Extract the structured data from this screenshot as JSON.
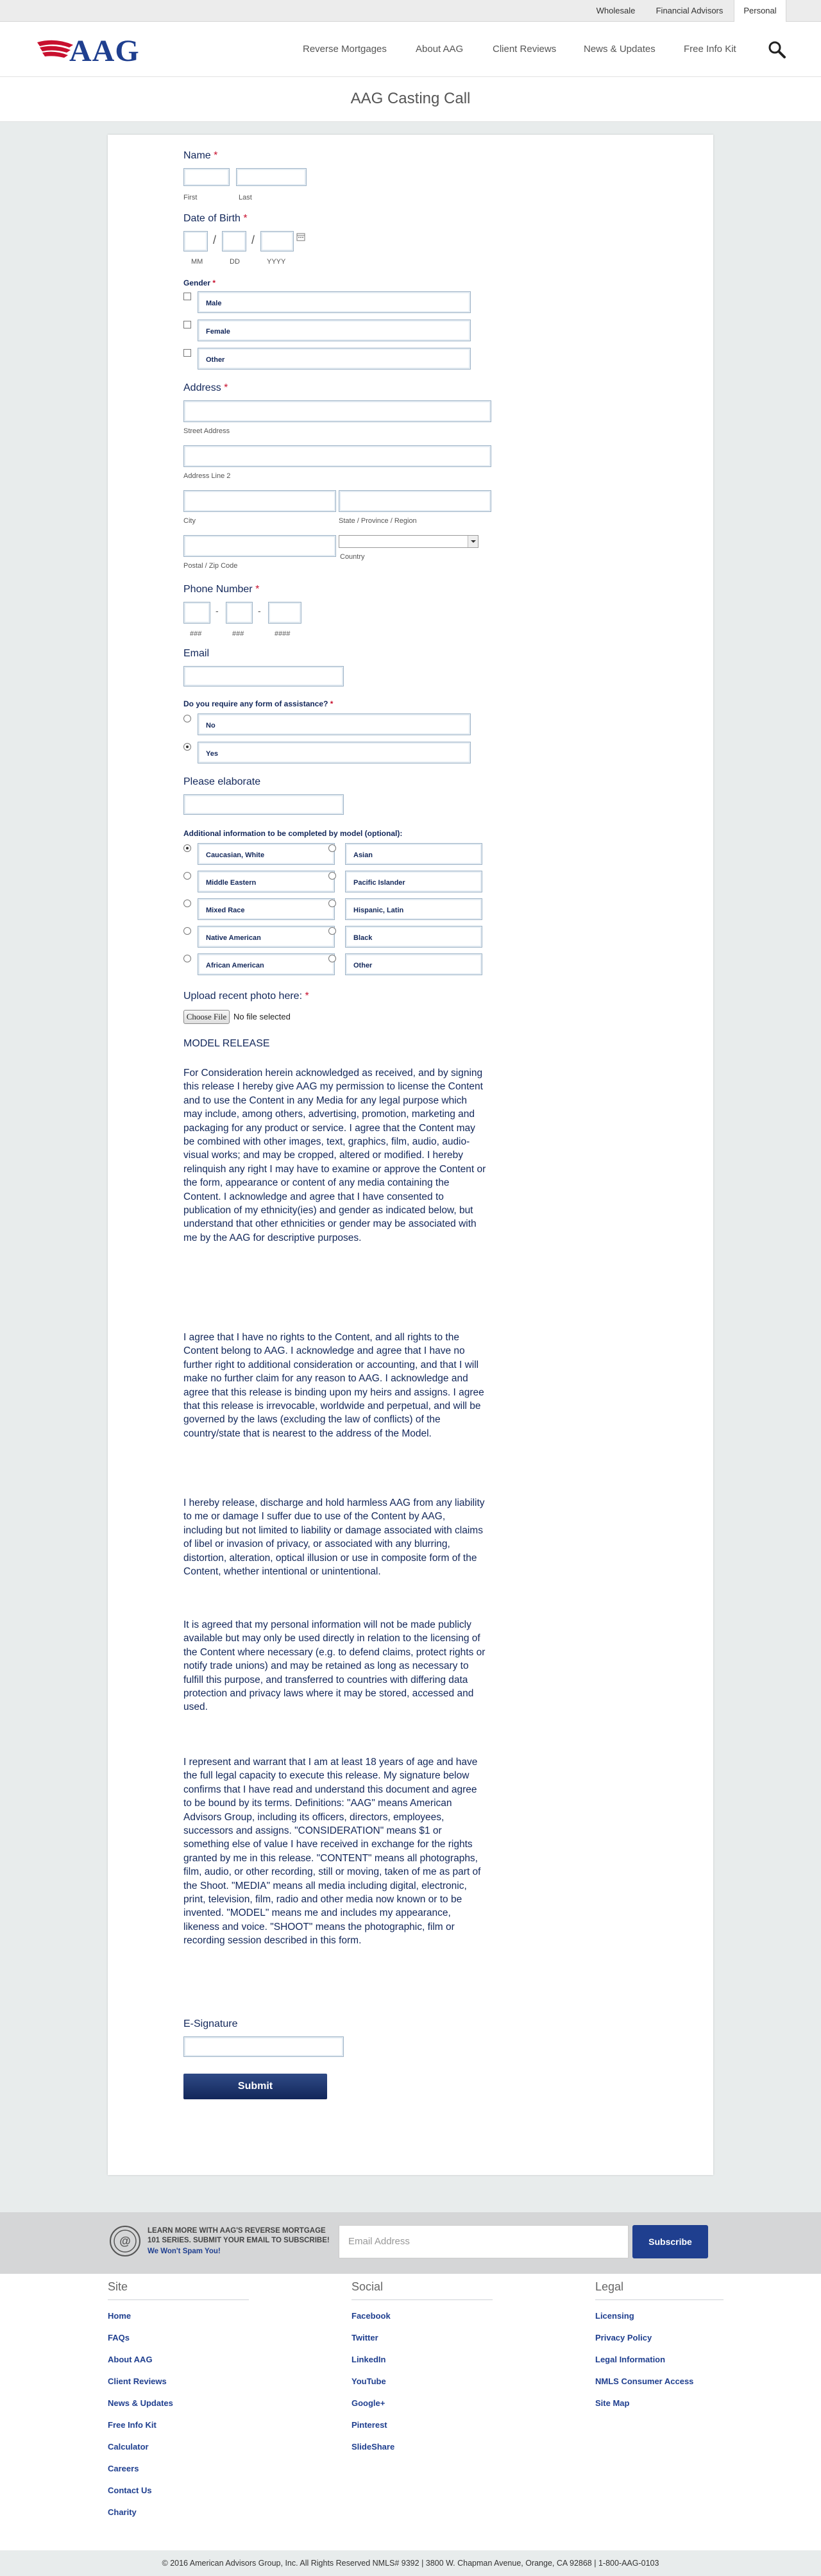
{
  "topbar": {
    "tabs": [
      "Wholesale",
      "Financial Advisors",
      "Personal"
    ]
  },
  "header": {
    "logo": "AAG",
    "nav": [
      "Reverse Mortgages",
      "About AAG",
      "Client Reviews",
      "News & Updates",
      "Free Info Kit"
    ]
  },
  "page": {
    "title": "AAG Casting Call"
  },
  "form": {
    "name": {
      "label": "Name",
      "req": "*",
      "first": "First",
      "last": "Last"
    },
    "dob": {
      "label": "Date of Birth",
      "req": "*",
      "mm": "MM",
      "dd": "DD",
      "yyyy": "YYYY",
      "sep": "/"
    },
    "gender": {
      "label": "Gender",
      "req": "*",
      "options": [
        "Male",
        "Female",
        "Other"
      ]
    },
    "address": {
      "label": "Address",
      "req": "*",
      "street": "Street Address",
      "line2": "Address Line 2",
      "city": "City",
      "state": "State / Province / Region",
      "postal": "Postal / Zip Code",
      "country": "Country"
    },
    "phone": {
      "label": "Phone Number",
      "req": "*",
      "area": "###",
      "prefix": "###",
      "line": "####",
      "sep": "-"
    },
    "email": {
      "label": "Email"
    },
    "assistance": {
      "label": "Do you require any form of assistance?",
      "req": "*",
      "options": [
        "No",
        "Yes"
      ],
      "selected": "Yes"
    },
    "elaborate": {
      "label": "Please elaborate"
    },
    "model_info": {
      "label": "Additional information to be completed by model (optional):",
      "left": [
        "Caucasian, White",
        "Middle Eastern",
        "Mixed Race",
        "Native American",
        "African American"
      ],
      "right": [
        "Asian",
        "Pacific Islander",
        "Hispanic, Latin",
        "Black",
        "Other"
      ],
      "selected": "Caucasian, White"
    },
    "upload": {
      "label": "Upload recent photo here:",
      "req": "*",
      "button": "Choose File",
      "status": "No file selected"
    },
    "release": {
      "heading": "MODEL RELEASE",
      "paragraphs": [
        "For Consideration herein acknowledged as received, and by signing this release I hereby give AAG my permission to license the Content and to use the Content in any Media for any legal purpose which may include, among others, advertising, promotion, marketing and packaging for any product or service. I agree that the Content may be combined with other images, text, graphics, film, audio, audio-visual works; and may be cropped, altered or modified. I hereby relinquish any right I may have to examine or approve the Content or the form, appearance or content of any media containing the Content. I acknowledge and agree that I have consented to publication of my ethnicity(ies) and gender as indicated below, but understand that other ethnicities or gender may be associated with me by the AAG for descriptive purposes.",
        "I agree that I have no rights to the Content, and all rights to the Content belong to AAG. I acknowledge and agree that I have no further right to additional consideration or accounting, and that I will make no further claim for any reason to AAG. I acknowledge and agree that this release is binding upon my heirs and assigns. I agree that this release is irrevocable, worldwide and perpetual, and will be governed by the laws (excluding the law of conflicts) of the country/state that is nearest to the address of the Model.",
        "I hereby release, discharge and hold harmless AAG from any liability to me or damage I suffer due to use of the Content by AAG, including but not limited to liability or damage associated with claims of libel or invasion of privacy, or associated with any blurring, distortion, alteration, optical illusion or use in composite form of the Content, whether intentional or unintentional.",
        "It is agreed that my personal information will not be made publicly available but may only be used directly in relation to the licensing of the Content where necessary (e.g. to defend claims, protect rights or notify trade unions) and may be retained as long as necessary to fulfill this purpose, and transferred to countries with differing data protection and privacy laws where it may be stored, accessed and used.",
        "I represent and warrant that I am at least 18 years of age and have the full legal capacity to execute this release. My signature below confirms that I have read and understand this document and agree to be bound by its terms. Definitions: \"AAG\" means American Advisors Group, including its officers, directors, employees, successors and assigns. \"CONSIDERATION\" means $1 or something else of value I have received in exchange for the rights granted by me in this release. \"CONTENT\" means all photographs, film, audio, or other recording, still or moving, taken of me as part of the Shoot. \"MEDIA\" means all media including digital, electronic, print, television, film, radio and other media now known or to be invented. \"MODEL\" means me and includes my appearance, likeness and voice. \"SHOOT\" means the photographic, film or recording session described in this form."
      ]
    },
    "esignature": {
      "label": "E-Signature"
    },
    "submit": "Submit"
  },
  "newsletter": {
    "line1": "LEARN MORE WITH AAG'S REVERSE MORTGAGE",
    "line2": "101 SERIES. SUBMIT YOUR EMAIL TO SUBSCRIBE!",
    "nospam": "We Won't Spam You!",
    "placeholder": "Email Address",
    "button": "Subscribe"
  },
  "footer": {
    "site": {
      "heading": "Site",
      "links": [
        "Home",
        "FAQs",
        "About AAG",
        "Client Reviews",
        "News & Updates",
        "Free Info Kit",
        "Calculator",
        "Careers",
        "Contact Us",
        "Charity"
      ]
    },
    "social": {
      "heading": "Social",
      "links": [
        "Facebook",
        "Twitter",
        "LinkedIn",
        "YouTube",
        "Google+",
        "Pinterest",
        "SlideShare"
      ]
    },
    "legal": {
      "heading": "Legal",
      "links": [
        "Licensing",
        "Privacy Policy",
        "Legal Information",
        "NMLS Consumer Access",
        "Site Map"
      ]
    },
    "copyright": "© 2016 American Advisors Group, Inc. All Rights Reserved NMLS# 9392 | 3800 W. Chapman Avenue, Orange, CA 92868 | 1-800-AAG-0103"
  },
  "colors": {
    "brand": "#1f3f8f",
    "text": "#12275a",
    "required": "#c8102e",
    "background": "#e8ecec"
  }
}
